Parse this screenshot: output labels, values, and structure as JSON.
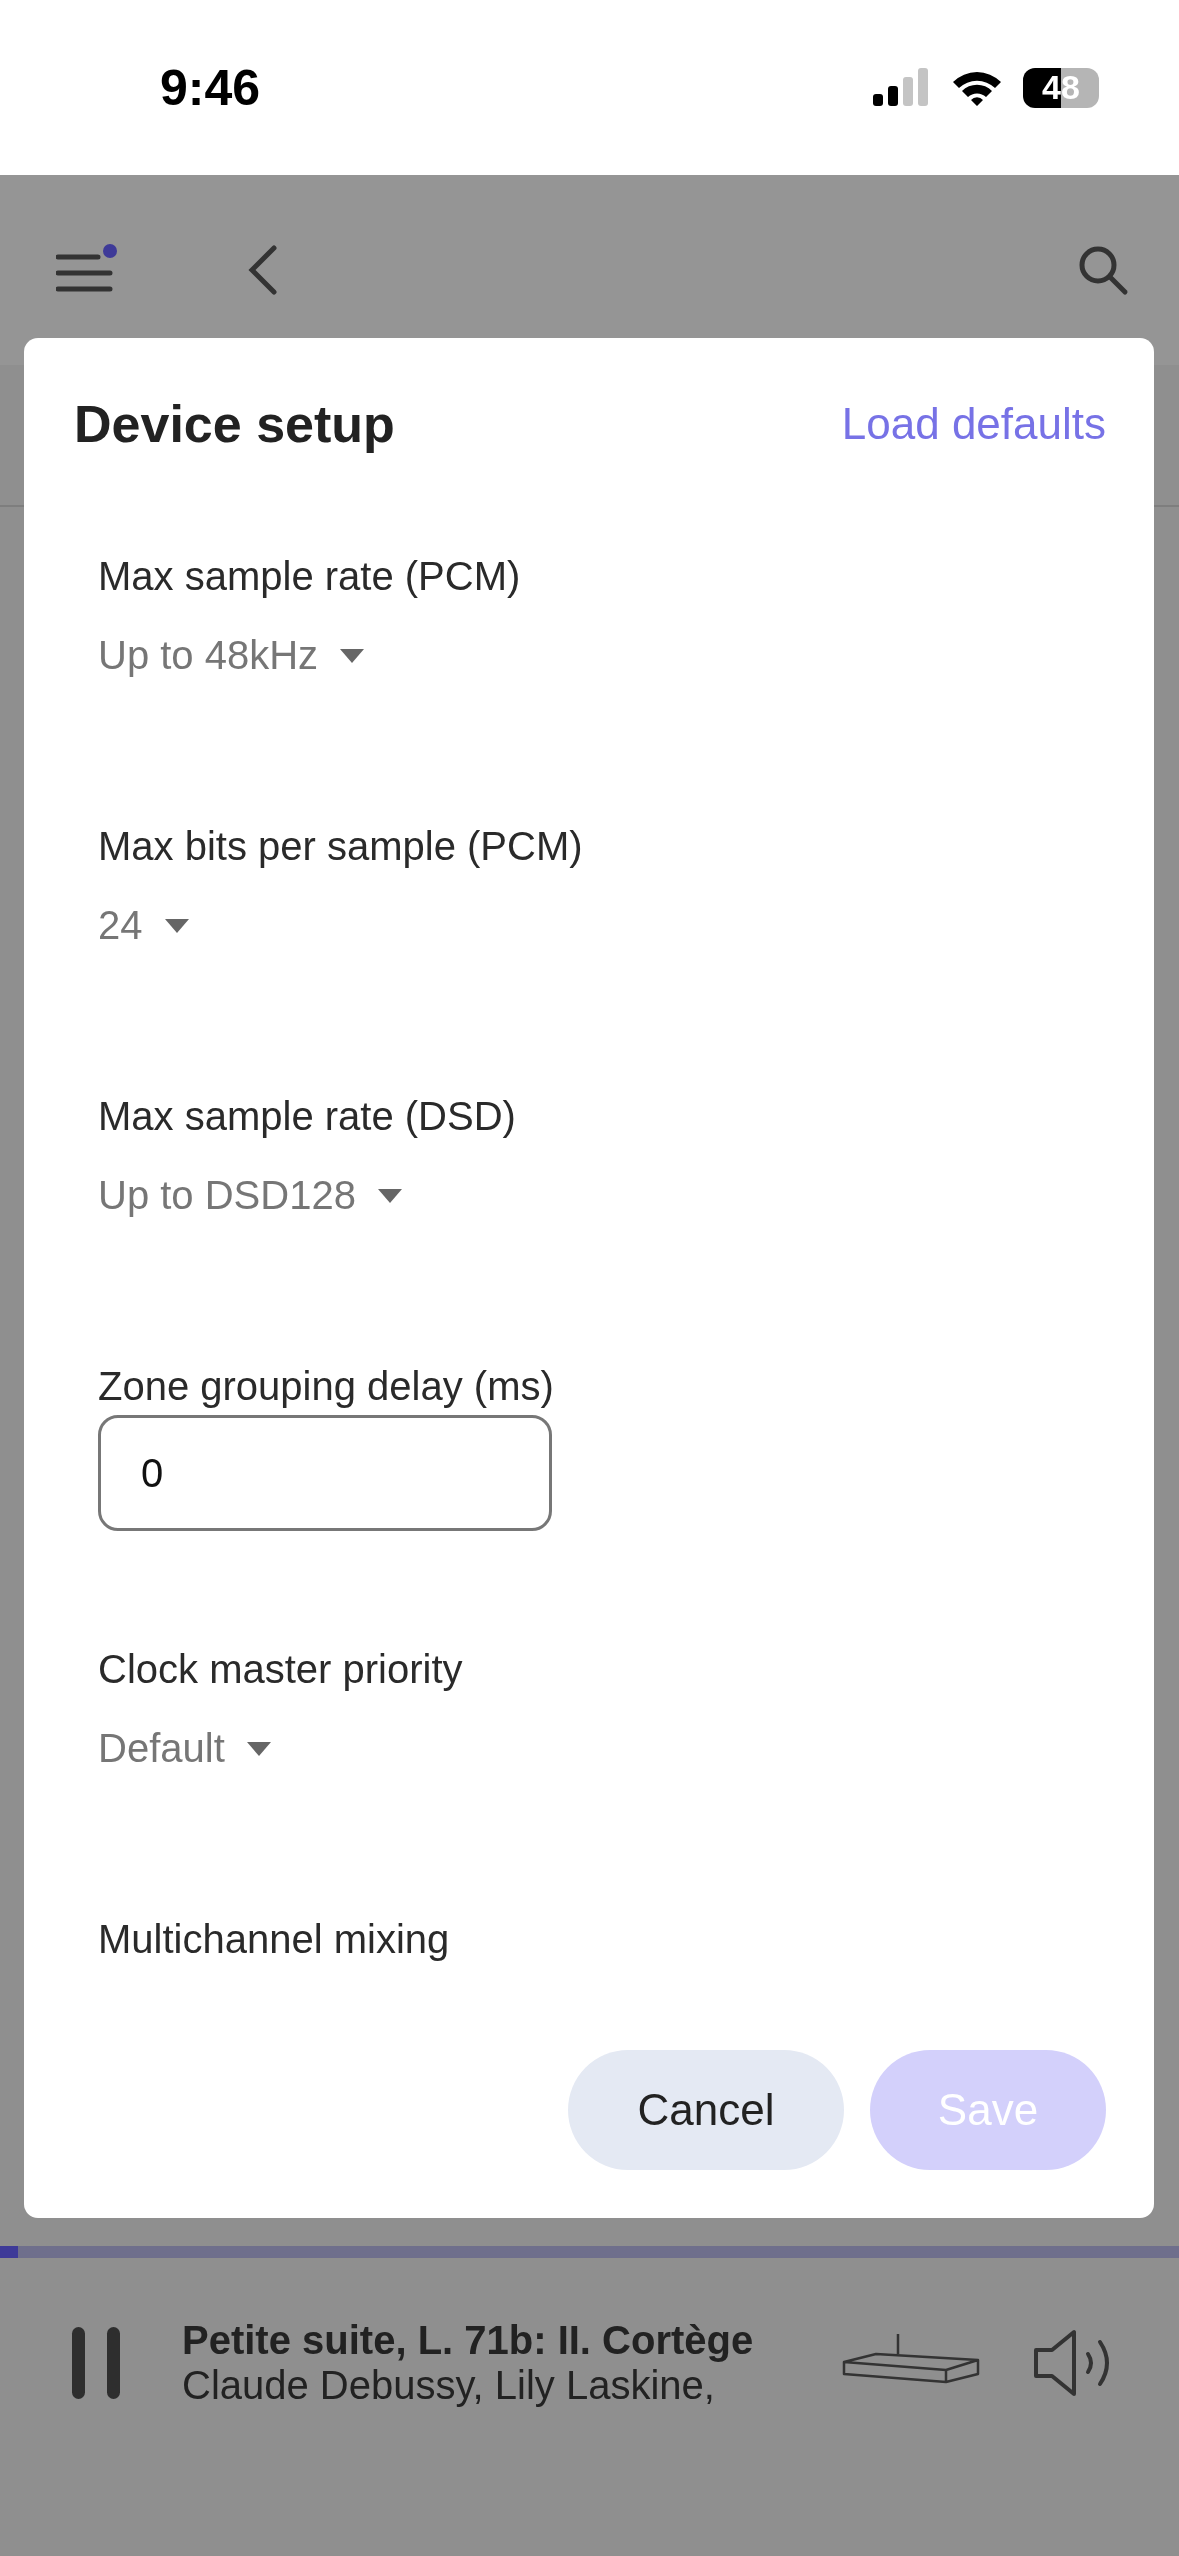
{
  "status_bar": {
    "time": "9:46",
    "battery": "48"
  },
  "header": {
    "menu_notification": true
  },
  "dialog": {
    "title": "Device setup",
    "action": "Load defaults",
    "fields": [
      {
        "kind": "select",
        "label": "Max sample rate (PCM)",
        "value": "Up to 48kHz"
      },
      {
        "kind": "select",
        "label": "Max bits per sample (PCM)",
        "value": "24"
      },
      {
        "kind": "select",
        "label": "Max sample rate (DSD)",
        "value": "Up to DSD128"
      },
      {
        "kind": "input",
        "label": "Zone grouping delay (ms)",
        "value": "0"
      },
      {
        "kind": "select",
        "label": "Clock master priority",
        "value": "Default"
      },
      {
        "kind": "heading",
        "label": "Multichannel mixing"
      }
    ],
    "buttons": [
      {
        "label": "Cancel",
        "kind": "secondary",
        "disabled": false
      },
      {
        "label": "Save",
        "kind": "primary",
        "disabled": true
      }
    ]
  },
  "player": {
    "level": 0.015,
    "playing": true,
    "title": "Petite suite, L. 71b: II. Cortège",
    "artist": "Claude Debussy, Lily Laskine,"
  }
}
